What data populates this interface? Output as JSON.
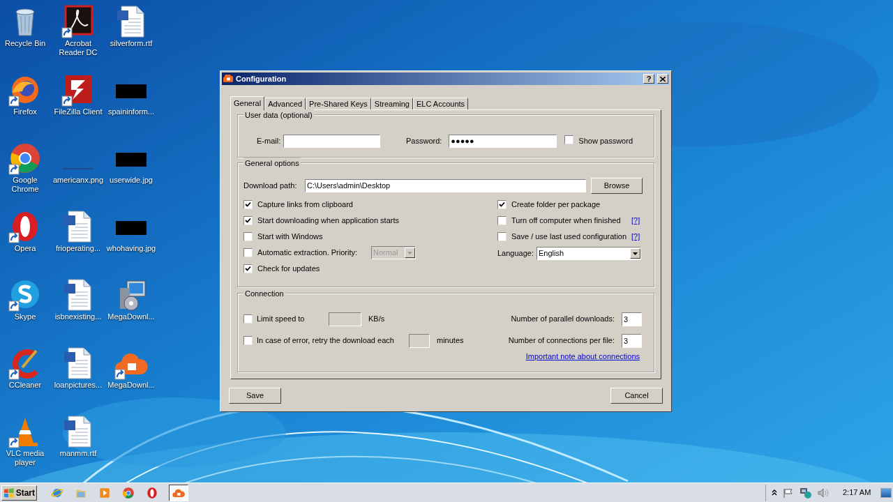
{
  "desktop_icons": [
    {
      "label": "Recycle Bin",
      "kind": "trash",
      "shortcut": false
    },
    {
      "label": "Acrobat Reader DC",
      "kind": "pdf",
      "shortcut": true
    },
    {
      "label": "silverform.rtf",
      "kind": "doc",
      "shortcut": false
    },
    {
      "label": "Firefox",
      "kind": "fox",
      "shortcut": true
    },
    {
      "label": "FileZilla Client",
      "kind": "ftp",
      "shortcut": true
    },
    {
      "label": "spaininform...",
      "kind": "hidden",
      "shortcut": false
    },
    {
      "label": "Google Chrome",
      "kind": "chrome",
      "shortcut": true
    },
    {
      "label": "americanx.png",
      "kind": "thin",
      "shortcut": false
    },
    {
      "label": "userwide.jpg",
      "kind": "hidden",
      "shortcut": false
    },
    {
      "label": "Opera",
      "kind": "opera",
      "shortcut": true
    },
    {
      "label": "frioperating...",
      "kind": "doc",
      "shortcut": false
    },
    {
      "label": "whohaving.jpg",
      "kind": "hidden",
      "shortcut": false
    },
    {
      "label": "Skype",
      "kind": "skype",
      "shortcut": true
    },
    {
      "label": "isbnexisting...",
      "kind": "doc",
      "shortcut": false
    },
    {
      "label": "MegaDownl...",
      "kind": "installer",
      "shortcut": false
    },
    {
      "label": "CCleaner",
      "kind": "cleaner",
      "shortcut": true
    },
    {
      "label": "loanpictures...",
      "kind": "doc",
      "shortcut": false
    },
    {
      "label": "MegaDownl...",
      "kind": "cloud",
      "shortcut": true
    },
    {
      "label": "VLC media player",
      "kind": "cone",
      "shortcut": true
    },
    {
      "label": "manmm.rtf",
      "kind": "doc",
      "shortcut": false
    }
  ],
  "dialog": {
    "title": "Configuration",
    "help_button": "?",
    "tabs": [
      {
        "label": "General",
        "selected": true
      },
      {
        "label": "Advanced",
        "selected": false
      },
      {
        "label": "Pre-Shared Keys",
        "selected": false
      },
      {
        "label": "Streaming",
        "selected": false
      },
      {
        "label": "ELC Accounts",
        "selected": false
      }
    ],
    "user_data": {
      "title": "User data (optional)",
      "email": {
        "label": "E-mail:"
      },
      "password": {
        "label": "Password:",
        "value": "●●●●●"
      },
      "show_password": {
        "label": "Show password",
        "checked": false
      }
    },
    "general_options": {
      "title": "General options",
      "download_path": {
        "label": "Download path:",
        "value": "C:\\Users\\admin\\Desktop"
      },
      "browse_button": "Browse",
      "left_options": [
        {
          "label": "Capture links from clipboard",
          "checked": true
        },
        {
          "label": "Start downloading when application starts",
          "checked": true
        },
        {
          "label": "Start with Windows",
          "checked": false
        },
        {
          "label": "Automatic extraction. Priority:",
          "checked": false,
          "dropdown": {
            "value": "Normal",
            "disabled": true
          }
        },
        {
          "label": "Check for updates",
          "checked": true
        }
      ],
      "right_options": [
        {
          "label": "Create folder per package",
          "checked": true
        },
        {
          "label": "Turn off computer when finished",
          "checked": false,
          "help": "[?]"
        },
        {
          "label": "Save / use last used configuration",
          "checked": false,
          "help": "[?]"
        }
      ],
      "language": {
        "label": "Language:",
        "value": "English"
      }
    },
    "connection": {
      "title": "Connection",
      "left_rows": [
        {
          "label": "Limit speed to",
          "checked": false,
          "unit": "KB/s",
          "disabled": true
        },
        {
          "label": "In case of error, retry the download each",
          "checked": false,
          "unit": "minutes",
          "disabled": true
        }
      ],
      "right_rows": [
        {
          "label": "Number of parallel downloads:",
          "value": "3"
        },
        {
          "label": "Number of connections per file:",
          "value": "3"
        }
      ],
      "link": "Important note about connections"
    },
    "buttons": [
      "Save",
      "Cancel"
    ]
  },
  "taskbar": {
    "start": "Start",
    "quick_launch": [
      {
        "kind": "globe"
      },
      {
        "kind": "folder"
      },
      {
        "kind": "player"
      },
      {
        "kind": "chrome"
      },
      {
        "kind": "opera"
      }
    ],
    "tasks": [
      {
        "kind": "cloud",
        "active": true
      }
    ],
    "clock": "2:17 AM"
  }
}
